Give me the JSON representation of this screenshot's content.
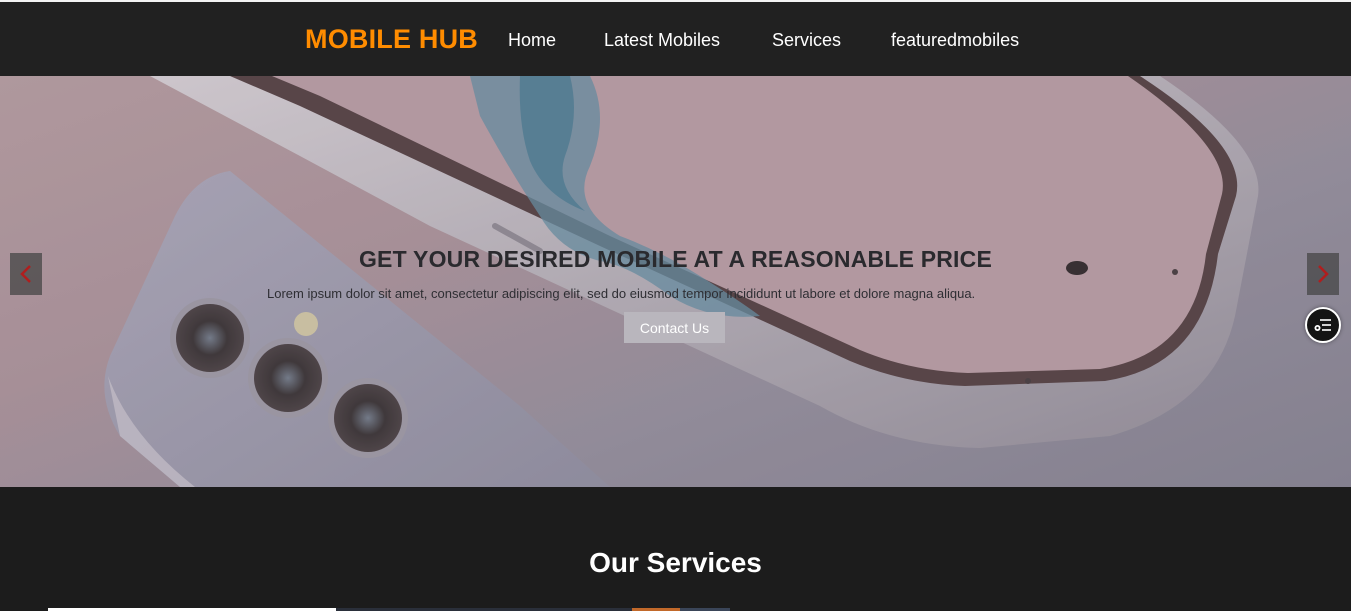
{
  "navbar": {
    "brand": "MOBILE HUB",
    "links": [
      "Home",
      "Latest Mobiles",
      "Services",
      "featuredmobiles"
    ]
  },
  "hero": {
    "title": "GET YOUR DESIRED MOBILE AT A REASONABLE PRICE",
    "text": "Lorem ipsum dolor sit amet, consectetur adipiscing elit, sed do eiusmod tempor incididunt ut labore et dolore magna aliqua.",
    "button": "Contact Us",
    "prev_icon": "chevron-left",
    "next_icon": "chevron-right"
  },
  "floating_button": {
    "icon": "settings-list"
  },
  "services": {
    "title": "Our Services"
  },
  "colors": {
    "brand": "#ff8c00",
    "nav_bg": "#212121",
    "page_bg": "#1c1c1c",
    "arrow": "#b01e1e"
  }
}
